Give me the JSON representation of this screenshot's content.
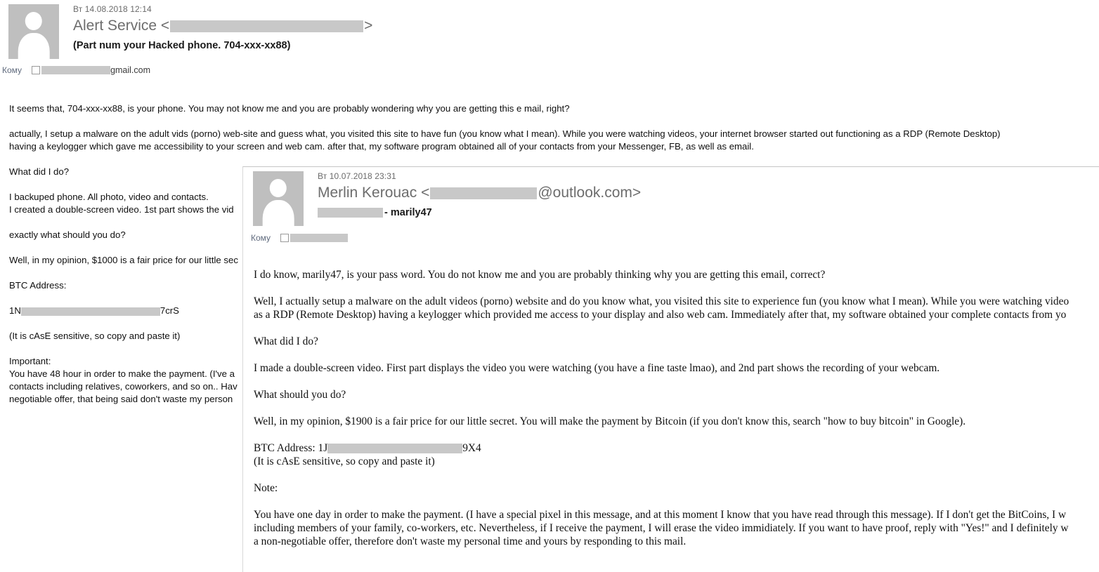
{
  "email1": {
    "date": "Вт 14.08.2018 12:14",
    "from_name": "Alert Service",
    "from_open": "<",
    "from_close": ">",
    "subject": "(Part num your Hacked phone. 704-xxx-xx88)",
    "to_label": "Кому",
    "to_suffix": "gmail.com",
    "body": {
      "p1": "It seems that, 704-xxx-xx88, is your phone. You may not know me and you are probably wondering why you are getting this e mail, right?",
      "p2_line1": "actually, I setup a malware on the adult vids (porno) web-site and guess what, you visited this site to have fun (you know what I mean). While you were watching videos, your internet browser started out functioning as a RDP (Remote Desktop)",
      "p2_line2": "having a keylogger which gave me accessibility to your screen and web cam. after that, my software program obtained all of your contacts from your Messenger, FB, as well as email.",
      "p3": "What did I do?",
      "p4_line1": "I backuped phone. All photo, video and contacts.",
      "p4_line2": "I created a double-screen video. 1st part shows the vid",
      "p5": "exactly what should you do?",
      "p6": "Well, in my opinion, $1000 is a fair price for our little sec",
      "p7": "BTC Address:",
      "btc_prefix": "1N",
      "btc_suffix": "7crS",
      "p8": "(It is cAsE sensitive, so copy and paste it)",
      "p9_label": "Important:",
      "p9_line1": "You have 48 hour in order to make the payment. (I've a",
      "p9_line2": "contacts including relatives, coworkers, and so on.. Hav",
      "p9_line3": "negotiable offer, that being said don't waste my person"
    }
  },
  "email2": {
    "date": "Вт 10.07.2018 23:31",
    "from_name": "Merlin Kerouac",
    "from_open": "<",
    "from_domain": "@outlook.com>",
    "subject_suffix": "- marily47",
    "to_label": "Кому",
    "body": {
      "p1": "I do know, marily47, is your pass word. You do not know me and you are probably thinking why you are getting this email, correct?",
      "p2_line1": "Well, I actually setup a malware on the adult videos (porno) website and do you know what, you visited this site to experience fun (you know what I mean). While you were watching video",
      "p2_line2": "as a RDP (Remote Desktop) having a keylogger which provided me access to your display and also web cam. Immediately after that, my software obtained your complete contacts from yo",
      "p3": "What did I do?",
      "p4": "I made a double-screen video. First part displays the video you were watching (you have a fine taste lmao), and 2nd part shows the recording of your webcam.",
      "p5": "What should you do?",
      "p6": "Well, in my opinion, $1900 is a fair price for our little secret. You will make the payment by Bitcoin (if you don't know this, search \"how to buy bitcoin\" in Google).",
      "btc_label": "BTC Address: 1J",
      "btc_suffix": "9X4",
      "p7": "(It is cAsE sensitive, so copy and paste it)",
      "p8_label": "Note:",
      "p9_line1": "You have one day in order to make the payment. (I have a special pixel in this message, and at this moment I know that you have read through this message). If I don't get the BitCoins, I w",
      "p9_line2": "including members of your family, co-workers, etc. Nevertheless, if I receive the payment, I will erase the video immidiately. If you want to have proof, reply with \"Yes!\" and I definitely w",
      "p9_line3": "a non-negotiable offer, therefore don't waste my personal time and yours by responding to this mail."
    }
  },
  "colors": {
    "redaction": "#c8c8c8",
    "header_gray": "#6d6d6d",
    "avatar_gray": "#bfbfbf",
    "to_label": "#5f6a7d"
  }
}
